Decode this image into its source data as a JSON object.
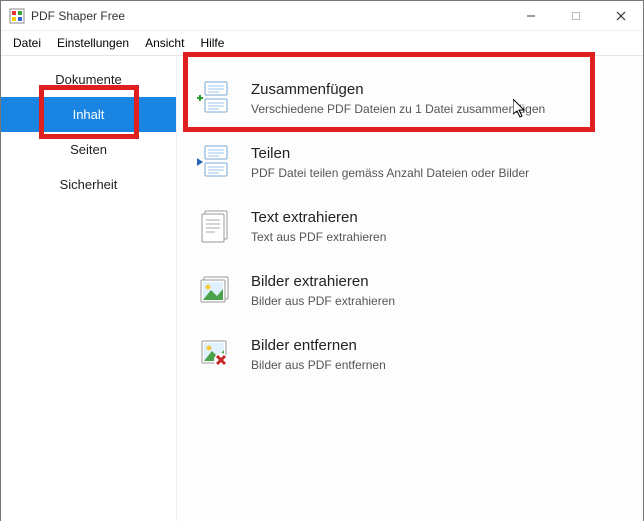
{
  "window": {
    "title": "PDF Shaper Free"
  },
  "menu": {
    "file": "Datei",
    "settings": "Einstellungen",
    "view": "Ansicht",
    "help": "Hilfe"
  },
  "sidebar": {
    "documents": "Dokumente",
    "content": "Inhalt",
    "pages": "Seiten",
    "security": "Sicherheit"
  },
  "actions": {
    "merge": {
      "title": "Zusammenfügen",
      "desc": "Verschiedene PDF Dateien zu 1 Datei zusammenfügen"
    },
    "split": {
      "title": "Teilen",
      "desc": "PDF Datei teilen gemäss Anzahl Dateien oder Bilder"
    },
    "extractText": {
      "title": "Text extrahieren",
      "desc": "Text aus PDF extrahieren"
    },
    "extractImages": {
      "title": "Bilder extrahieren",
      "desc": "Bilder aus PDF extrahieren"
    },
    "removeImages": {
      "title": "Bilder entfernen",
      "desc": "Bilder aus PDF entfernen"
    }
  }
}
